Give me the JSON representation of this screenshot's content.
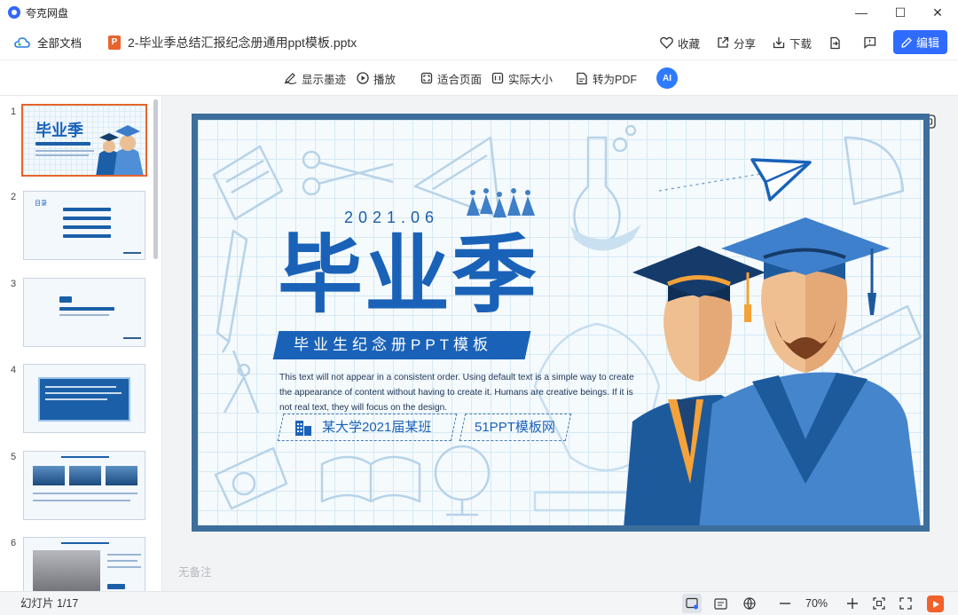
{
  "app": {
    "title": "夸克网盘"
  },
  "window": {
    "minimize": "—",
    "maximize": "☐",
    "close": "✕"
  },
  "docbar": {
    "all_docs": "全部文档",
    "file_icon": "P",
    "filename": "2-毕业季总结汇报纪念册通用ppt模板.pptx",
    "favorite": "收藏",
    "share": "分享",
    "download": "下载",
    "edit": "编辑"
  },
  "toolbar": {
    "show_ink": "显示墨迹",
    "play": "播放",
    "fit_page": "适合页面",
    "actual_size": "实际大小",
    "to_pdf": "转为PDF",
    "ai_label": "AI"
  },
  "sidebar": {
    "thumbnails": [
      {
        "num": "1",
        "title": "毕业季"
      },
      {
        "num": "2",
        "title": "目录"
      },
      {
        "num": "3",
        "title": ""
      },
      {
        "num": "4",
        "title": ""
      },
      {
        "num": "5",
        "title": ""
      },
      {
        "num": "6",
        "title": ""
      }
    ]
  },
  "slide": {
    "date": "2021.06",
    "title": "毕业季",
    "banner": "毕业生纪念册PPT模板",
    "body": "This text will not appear in a consistent order. Using default text is a simple way to create the appearance of content without having to create it. Humans are creative beings. If it is not real text, they will focus on the design.",
    "tag1": "某大学2021届某班",
    "tag2": "51PPT模板网"
  },
  "notes": {
    "placeholder": "无备注"
  },
  "status": {
    "slide_count": "幻灯片 1/17",
    "zoom": "70%"
  },
  "colors": {
    "accent": "#2f6bff",
    "slide_blue": "#1a62b8",
    "active_thumb": "#e8642c"
  }
}
